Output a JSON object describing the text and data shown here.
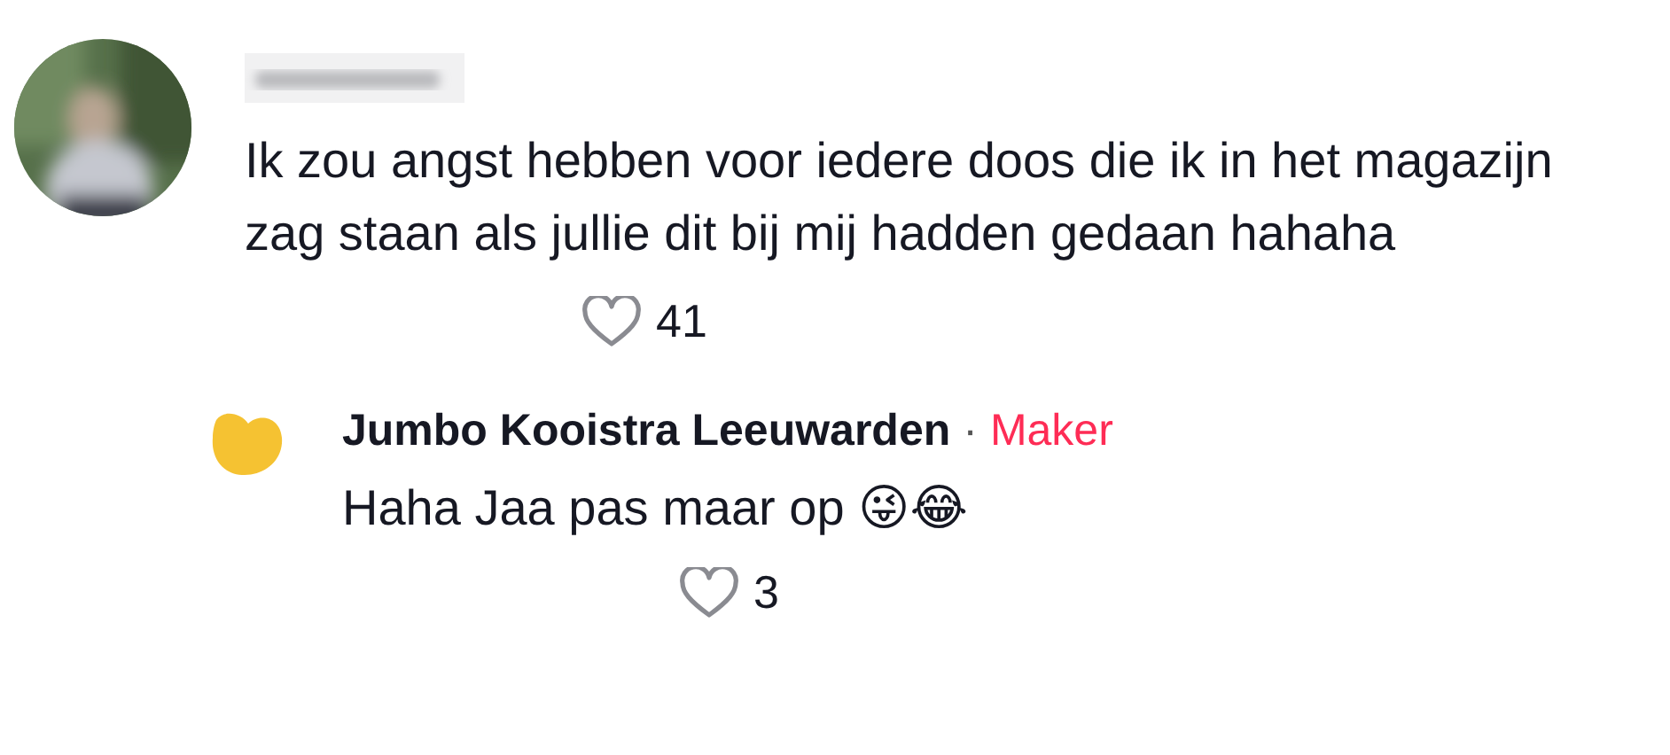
{
  "comment": {
    "kind": "picture",
    "text": "Ik zou angst hebben voor iedere doos die ik in het magazijn zag staan als jullie dit bij mij hadden gedaan hahaha",
    "likes": "41"
  },
  "reply": {
    "author": "Jumbo Kooistra Leeuwarden",
    "separator": "·",
    "badge": "Maker",
    "text": "Haha Jaa pas maar op 😜😂",
    "likes": "3"
  }
}
